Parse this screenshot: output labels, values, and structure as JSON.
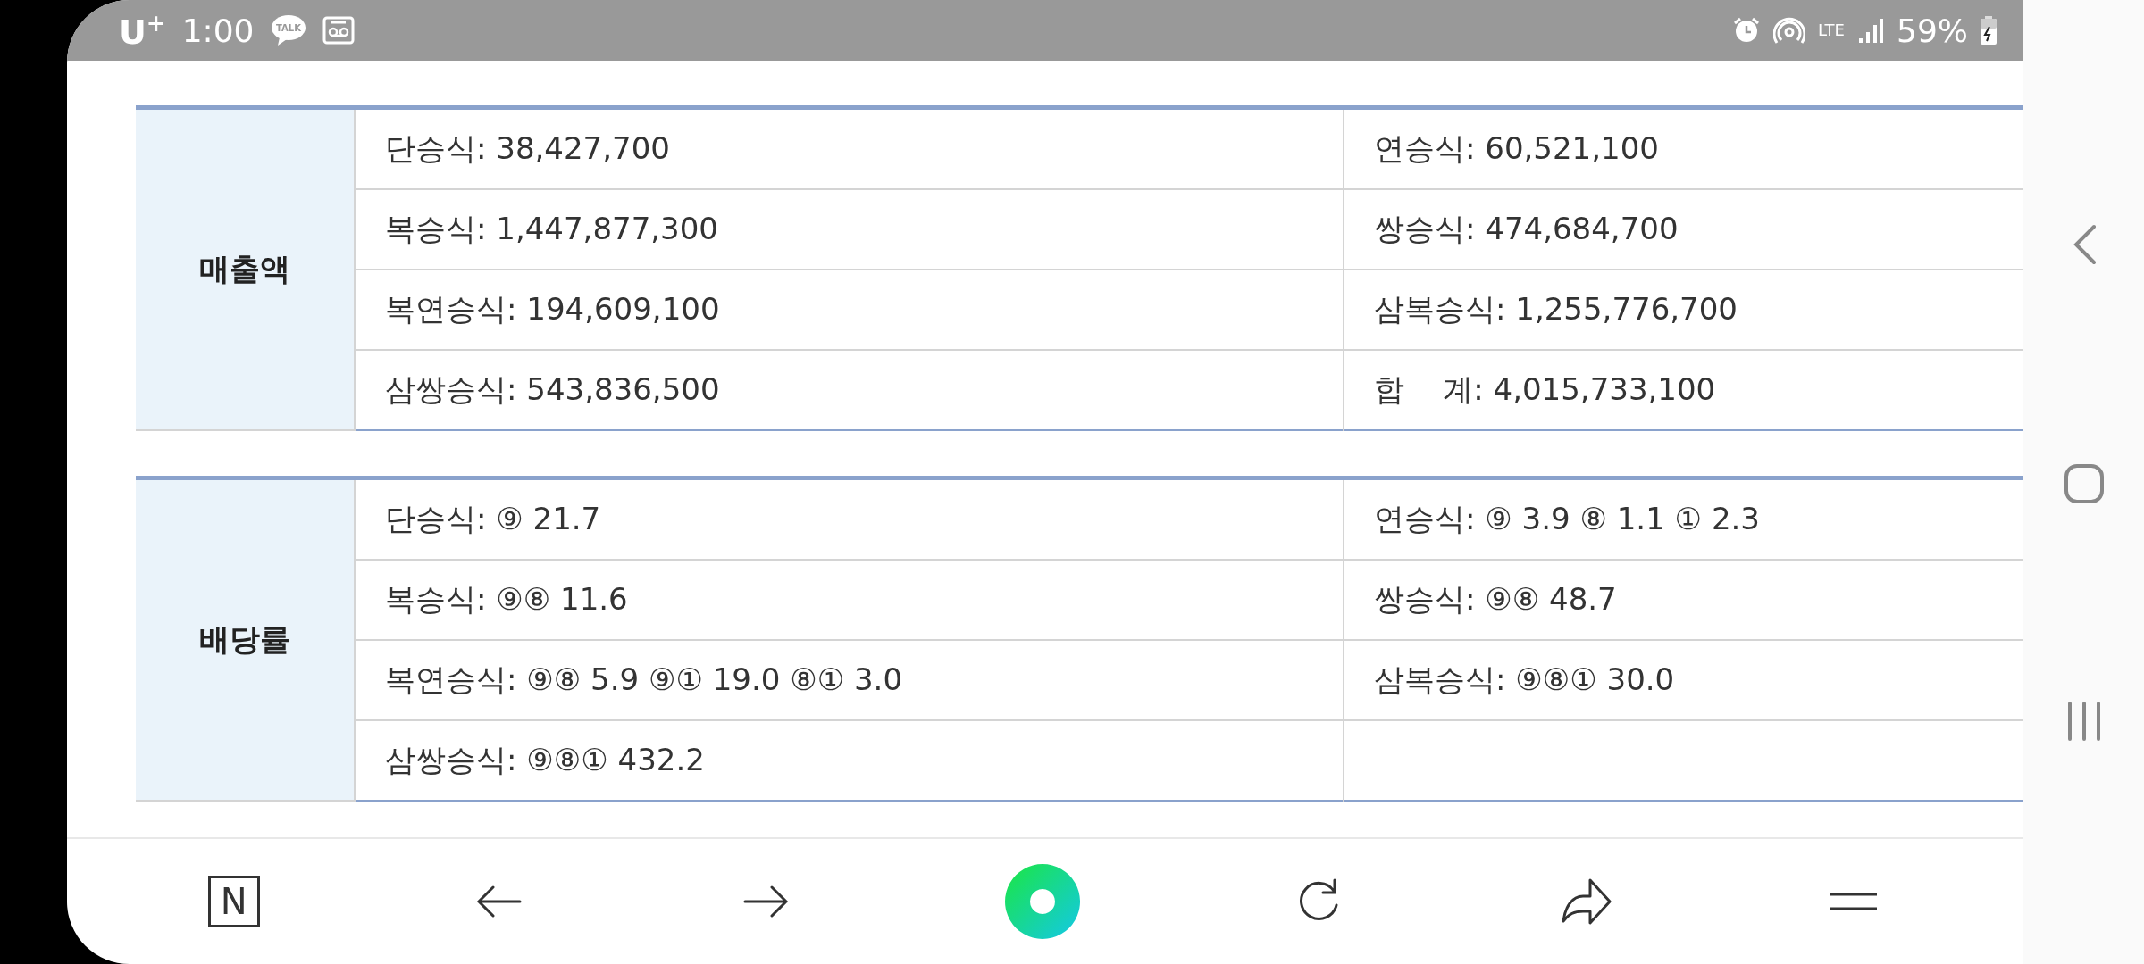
{
  "status_bar": {
    "carrier": "U$^{+}$",
    "time": "1:00",
    "talk_badge": "TALK",
    "network": "LTE",
    "battery": "59%"
  },
  "tables": [
    {
      "header": "매출액",
      "rows": [
        [
          "단승식: 38,427,700",
          "연승식: 60,521,100"
        ],
        [
          "복승식: 1,447,877,300",
          "쌍승식: 474,684,700"
        ],
        [
          "복연승식: 194,609,100",
          "삼복승식: 1,255,776,700"
        ],
        [
          "삼쌍승식: 543,836,500",
          "합    계: 4,015,733,100"
        ]
      ]
    },
    {
      "header": "배당률",
      "rows": [
        [
          "단승식: ⑨ 21.7",
          "연승식: ⑨ 3.9 ⑧ 1.1 ① 2.3"
        ],
        [
          "복승식: ⑨⑧ 11.6",
          "쌍승식: ⑨⑧ 48.7"
        ],
        [
          "복연승식: ⑨⑧ 5.9 ⑨① 19.0 ⑧① 3.0",
          "삼복승식: ⑨⑧① 30.0"
        ],
        [
          "삼쌍승식: ⑨⑧① 432.2"
        ]
      ]
    }
  ],
  "browser_toolbar": {
    "logo_letter": "N"
  }
}
